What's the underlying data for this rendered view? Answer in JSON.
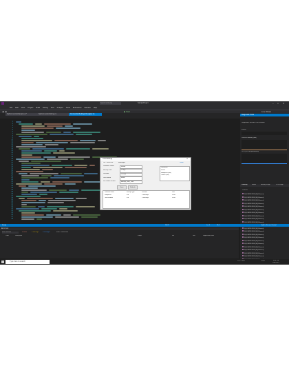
{
  "window": {
    "title": "",
    "search": "Search (Ctrl+Q)",
    "project": "SampleProject"
  },
  "menu": [
    "File",
    "Edit",
    "View",
    "Project",
    "Build",
    "Debug",
    "Test",
    "Analyze",
    "Tools",
    "Extensions",
    "Window",
    "Help"
  ],
  "toolbar": {
    "run_label": "Start",
    "live_share": "Live Share"
  },
  "tabs": [
    {
      "label": "SqlConnectionSample.cs*",
      "active": false
    },
    {
      "label": "SqlConnectionString.cs",
      "active": false
    },
    {
      "label": "ConnectionSettings.Designer.cs",
      "active": true
    }
  ],
  "editor": {
    "zoom": "100 %",
    "ln": "Ln: 4",
    "ch": "Ch: 1"
  },
  "right_panel": {
    "title": "Diagnostic Tools",
    "session": "Diagnostics session: 0:00 seconds",
    "events": "Events",
    "memory": "Process Memory (MB)",
    "cpu": "CPU (% of all processors)",
    "tabs": [
      "Summary",
      "Events",
      "Memory Usage",
      "CPU Usage"
    ],
    "process_header": "Process",
    "processes": [
      "SQLSRVR.EXE (SQLServer)",
      "SQLSRVR.EXE (SQLServer)",
      "SQLSRVR.EXE (SQLServer)",
      "SQLSRVR.EXE (SQLServer)",
      "SQLSRVR.EXE (SQLServer)",
      "SQLSRVR.EXE (SQLServer)",
      "SQLSRVR.EXE (SQLServer)",
      "SQLSRVR.EXE (SQLServer)",
      "SQLSRVR.EXE (SQLServer)",
      "SQLSRVR.EXE (SQLServer)",
      "SQLSRVR.EXE (SQLServer)",
      "SQLSRVR.EXE (SQLServer)",
      "SQLSRVR.EXE (SQLServer)",
      "SQLSRVR.EXE (SQLServer)",
      "SQLSRVR.EXE (SQLServer)",
      "SQLSRVR.EXE (SQLServer)",
      "SQLSRVR.EXE (SQLServer)",
      "SQLSRVR.EXE (SQLServer)",
      "SQLSRVR.EXE (SQLServer)",
      "SQLSRVR.EXE (SQLServer)",
      "SQLSRVR.EXE (SQLServer)",
      "SQLSRVR.EXE (SQLServer)"
    ]
  },
  "dialog": {
    "title": "ConnSettings",
    "tab_connection": "DB Connection",
    "tab_messages": "Messages",
    "fields": [
      {
        "label": "Database Name",
        "value": "Master"
      },
      {
        "label": "Backup Path",
        "value": "C:\\SQL"
      },
      {
        "label": "Location",
        "value": "C:\\Data"
      },
      {
        "label": "User Name",
        "value": "admin"
      },
      {
        "label": "File Name Format",
        "value": "Backup_Date_Time"
      }
    ],
    "save": "Save",
    "refresh": "Refresh",
    "close": "Close",
    "list_title": "Databases",
    "list_items": [
      "Master",
      "SampleDB (Full)",
      "TestDB (Full)"
    ],
    "grid_headers": [
      "Database Name",
      "Backup Type",
      "Location",
      "Size"
    ],
    "grid_rows": [
      [
        "SampleDB",
        "Full",
        "C:\\Backups",
        "5 MB"
      ],
      [
        "TestDatabase",
        "Full",
        "C:\\Backups",
        "3 MB"
      ]
    ]
  },
  "error_list": {
    "title": "Error List",
    "scope": "Entire Solution",
    "errors": "0 Errors",
    "warnings": "0 Warnings",
    "messages": "0 Messages",
    "build": "Build + IntelliSense",
    "headers": [
      "Code",
      "Description",
      "Project",
      "File",
      "Line",
      "Suppression State"
    ]
  },
  "status": {
    "ready": "Ready",
    "source_control": "Add to Source Control"
  },
  "taskbar": {
    "search": "Type here to search",
    "weather": "24°C Clear",
    "lang": "ENG",
    "time": "5:04 PM",
    "date": "10/8/2021"
  }
}
